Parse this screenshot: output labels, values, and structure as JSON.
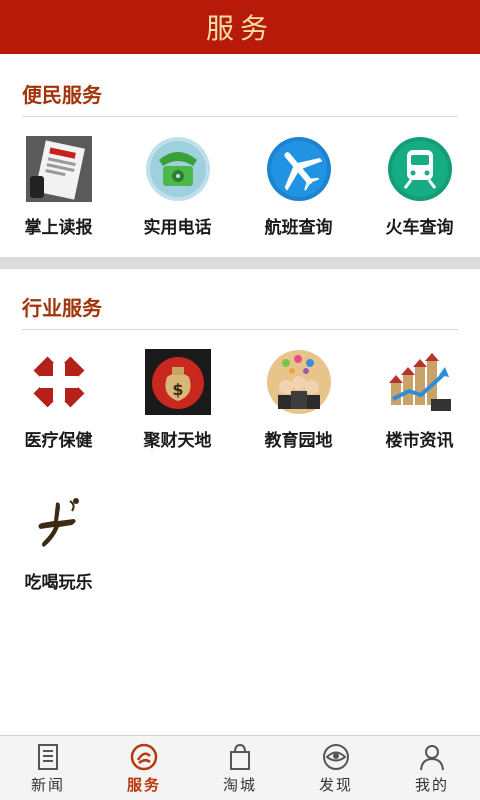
{
  "header": {
    "title": "服务"
  },
  "sections": [
    {
      "title": "便民服务",
      "items": [
        {
          "label": "掌上读报",
          "icon": "newspaper-icon"
        },
        {
          "label": "实用电话",
          "icon": "telephone-icon"
        },
        {
          "label": "航班查询",
          "icon": "airplane-icon"
        },
        {
          "label": "火车查询",
          "icon": "train-icon"
        }
      ]
    },
    {
      "title": "行业服务",
      "items": [
        {
          "label": "医疗保健",
          "icon": "medical-cross-icon"
        },
        {
          "label": "聚财天地",
          "icon": "money-bag-icon"
        },
        {
          "label": "教育园地",
          "icon": "education-people-icon"
        },
        {
          "label": "楼市资讯",
          "icon": "real-estate-chart-icon"
        },
        {
          "label": "吃喝玩乐",
          "icon": "food-fun-icon"
        }
      ]
    }
  ],
  "tabbar": [
    {
      "label": "新闻",
      "icon": "news-icon"
    },
    {
      "label": "服务",
      "icon": "service-icon",
      "active": true
    },
    {
      "label": "淘城",
      "icon": "shopping-bag-icon"
    },
    {
      "label": "发现",
      "icon": "discover-eye-icon"
    },
    {
      "label": "我的",
      "icon": "user-icon"
    }
  ],
  "colors": {
    "header_bg": "#b81a0a",
    "header_text": "#f4dfa8",
    "section_title": "#a1340b",
    "active_tab": "#b8380d"
  }
}
